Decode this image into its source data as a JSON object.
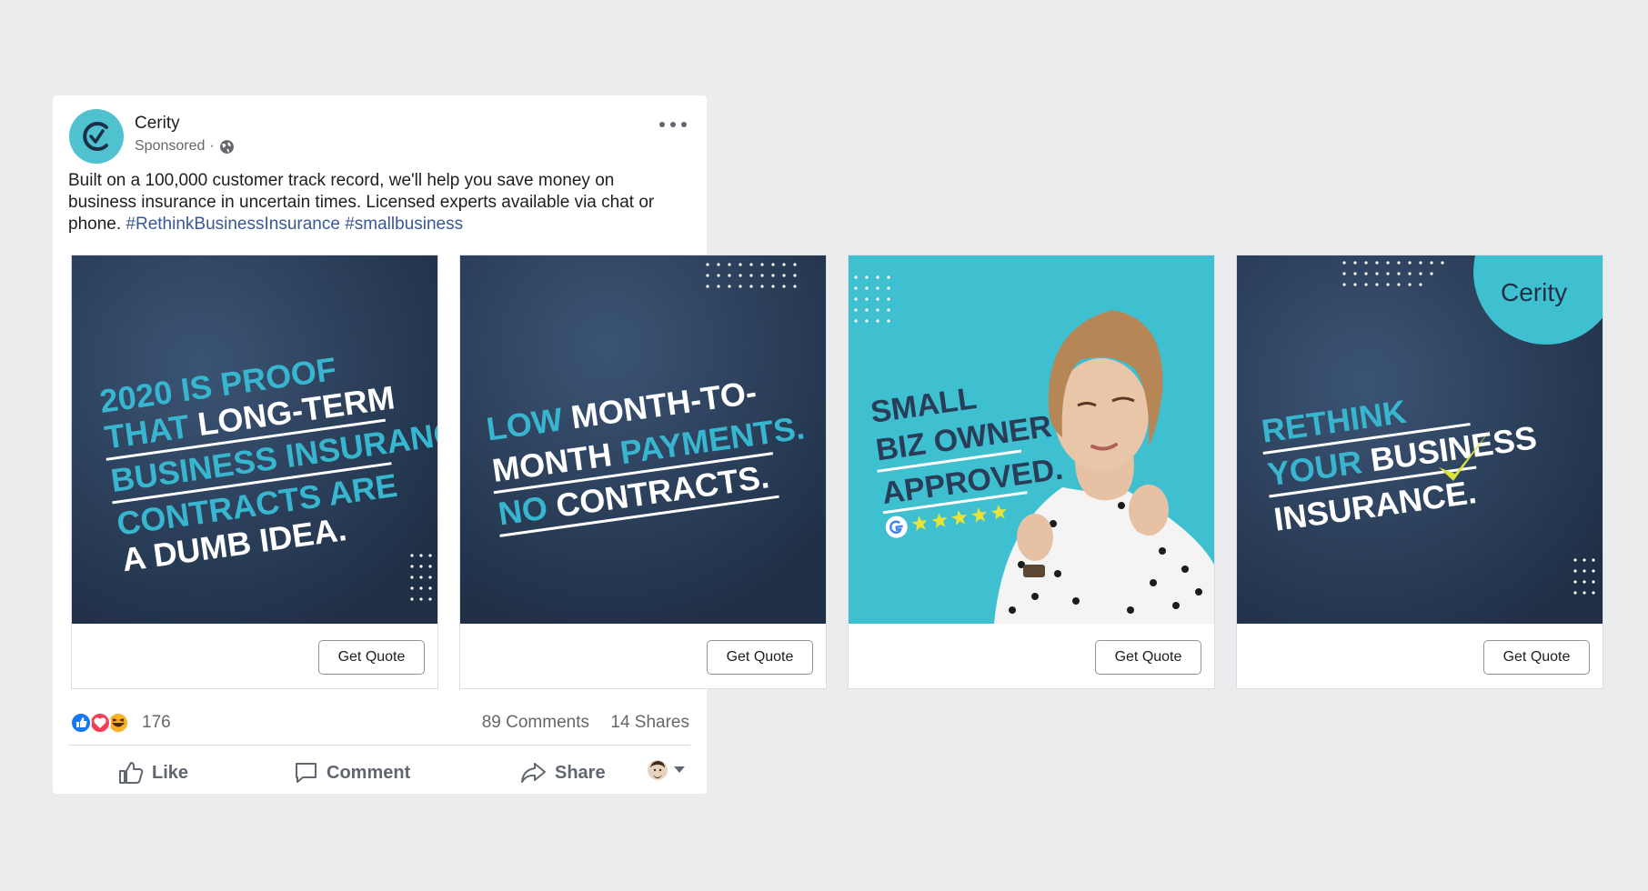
{
  "post": {
    "page_name": "Cerity",
    "sponsored_label": "Sponsored",
    "separator": "·",
    "body_text": "Built on a 100,000 customer track record, we'll help you save money on business insurance in uncertain times. Licensed experts available via chat or phone.",
    "hashtags": [
      "#RethinkBusinessInsurance",
      "#smallbusiness"
    ],
    "reaction_count": "176",
    "comments": "89 Comments",
    "shares": "14 Shares",
    "actions": {
      "like": "Like",
      "comment": "Comment",
      "share": "Share"
    }
  },
  "cards": [
    {
      "cta": "Get Quote",
      "headline_lines": [
        [
          {
            "t": "2020 IS PROOF",
            "c": "accent"
          }
        ],
        [
          {
            "t": "THAT ",
            "c": "accent"
          },
          {
            "t": "LONG-TERM",
            "c": "white"
          }
        ],
        [
          {
            "t": "BUSINESS INSURANCE",
            "c": "accent"
          }
        ],
        [
          {
            "t": "CONTRACTS ARE",
            "c": "accent"
          }
        ],
        [
          {
            "t": "A DUMB IDEA.",
            "c": "white"
          }
        ]
      ]
    },
    {
      "cta": "Get Quote",
      "headline_lines": [
        [
          {
            "t": "LOW ",
            "c": "accent"
          },
          {
            "t": "MONTH-TO-",
            "c": "white"
          }
        ],
        [
          {
            "t": "MONTH ",
            "c": "white"
          },
          {
            "t": "PAYMENTS.",
            "c": "accent"
          }
        ],
        [
          {
            "t": "NO ",
            "c": "accent"
          },
          {
            "t": "CONTRACTS.",
            "c": "white"
          }
        ]
      ]
    },
    {
      "cta": "Get Quote",
      "headline_lines": [
        [
          {
            "t": "SMALL",
            "c": "navy"
          }
        ],
        [
          {
            "t": "BIZ OWNER",
            "c": "navy"
          }
        ],
        [
          {
            "t": "APPROVED.",
            "c": "navy"
          }
        ]
      ],
      "rating_stars": 5
    },
    {
      "cta": "Get Quote",
      "logo_text": "Cerity",
      "headline_lines": [
        [
          {
            "t": "RETHINK",
            "c": "accent"
          }
        ],
        [
          {
            "t": "YOUR ",
            "c": "accent"
          },
          {
            "t": "BUSINESS",
            "c": "white"
          }
        ],
        [
          {
            "t": "INSURANCE.",
            "c": "white"
          }
        ]
      ]
    }
  ],
  "colors": {
    "brand_teal": "#4fc1cf",
    "accent_cyan": "#38b6cf",
    "navy": "#2a3d58",
    "check_yellow": "#d8e23a",
    "link_blue": "#385898"
  },
  "icons": [
    "cerity-logo-icon",
    "globe-icon",
    "more-options-icon",
    "like-reaction-icon",
    "love-reaction-icon",
    "haha-reaction-icon",
    "thumbs-up-icon",
    "comment-icon",
    "share-icon",
    "profile-avatar-icon",
    "caret-down-icon",
    "google-icon",
    "star-icon",
    "checkmark-icon"
  ]
}
